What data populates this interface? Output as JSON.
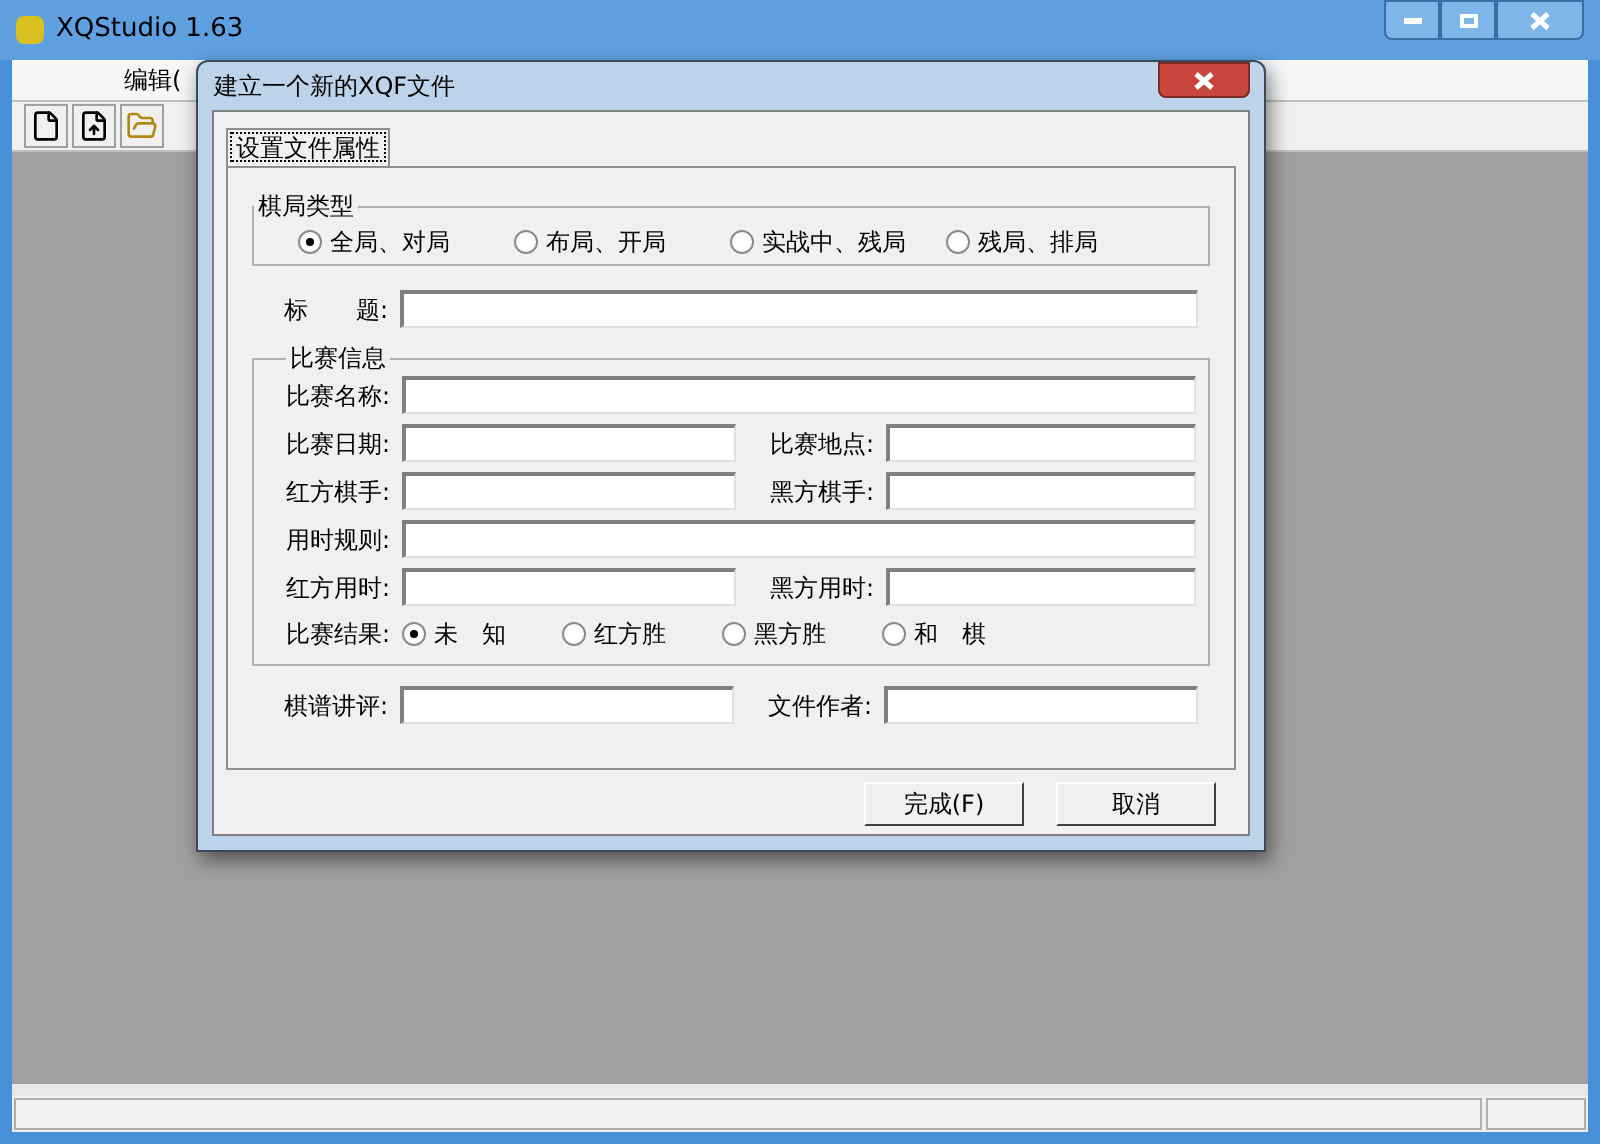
{
  "window": {
    "title": "XQStudio 1.63",
    "menu": [
      "编辑("
    ]
  },
  "dialog": {
    "title": "建立一个新的XQF文件",
    "tabs": [
      {
        "label": "设置文件属性",
        "selected": true
      }
    ],
    "game_type": {
      "legend": "棋局类型",
      "options": [
        {
          "label": "全局、对局",
          "selected": true
        },
        {
          "label": "布局、开局",
          "selected": false
        },
        {
          "label": "实战中、残局",
          "selected": false
        },
        {
          "label": "残局、排局",
          "selected": false
        }
      ]
    },
    "title_field": {
      "label": "标　　题:"
    },
    "match": {
      "legend": "比赛信息",
      "rows": [
        [
          {
            "label": "比赛名称:"
          }
        ],
        [
          {
            "label": "比赛日期:"
          },
          {
            "label": "比赛地点:"
          }
        ],
        [
          {
            "label": "红方棋手:"
          },
          {
            "label": "黑方棋手:"
          }
        ],
        [
          {
            "label": "用时规则:"
          }
        ],
        [
          {
            "label": "红方用时:"
          },
          {
            "label": "黑方用时:"
          }
        ]
      ],
      "result": {
        "label": "比赛结果:",
        "options": [
          {
            "label": "未　知",
            "selected": true
          },
          {
            "label": "红方胜",
            "selected": false
          },
          {
            "label": "黑方胜",
            "selected": false
          },
          {
            "label": "和　棋",
            "selected": false
          }
        ]
      }
    },
    "bottom_fields": [
      {
        "label": "棋谱讲评:"
      },
      {
        "label": "文件作者:"
      }
    ],
    "buttons": [
      "完成(F)",
      "取消"
    ]
  }
}
